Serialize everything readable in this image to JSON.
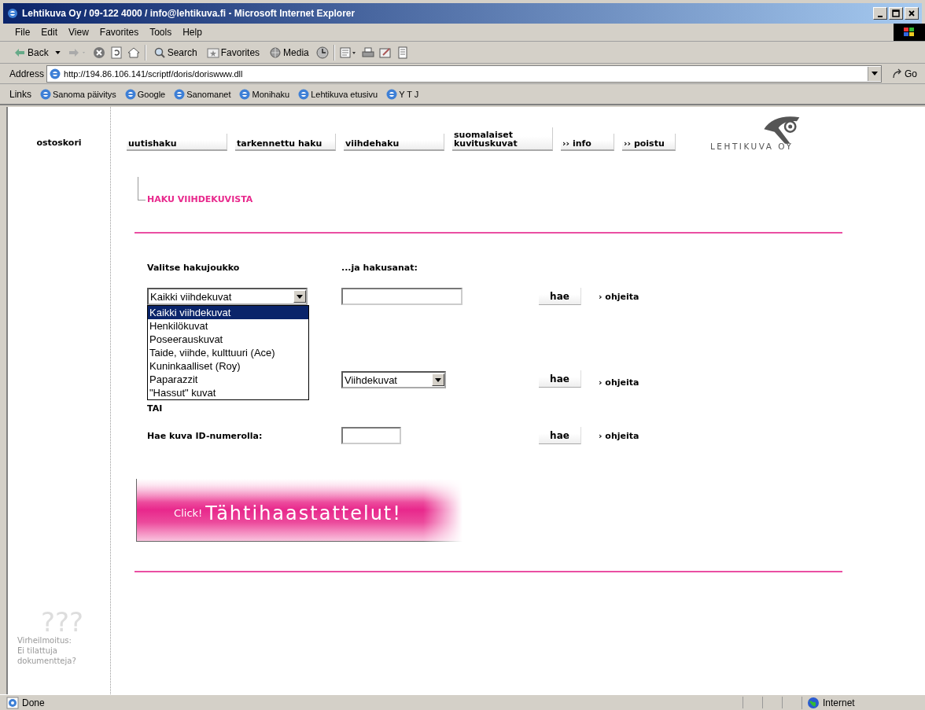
{
  "window": {
    "title": "Lehtikuva Oy / 09-122 4000 / info@lehtikuva.fi - Microsoft Internet Explorer"
  },
  "menu": [
    "File",
    "Edit",
    "View",
    "Favorites",
    "Tools",
    "Help"
  ],
  "toolbar": [
    {
      "kind": "back",
      "label": "Back"
    },
    {
      "kind": "forward"
    },
    {
      "kind": "stop"
    },
    {
      "kind": "refresh"
    },
    {
      "kind": "home"
    },
    {
      "kind": "search",
      "label": "Search"
    },
    {
      "kind": "favorites",
      "label": "Favorites"
    },
    {
      "kind": "media",
      "label": "Media"
    },
    {
      "kind": "history"
    },
    {
      "kind": "mail"
    },
    {
      "kind": "print"
    },
    {
      "kind": "edit"
    },
    {
      "kind": "discuss"
    }
  ],
  "address": {
    "label": "Address",
    "url": "http://194.86.106.141/scriptf/doris/doriswww.dll",
    "go": "Go"
  },
  "links": {
    "label": "Links",
    "items": [
      "Sanoma päivitys",
      "Google",
      "Sanomanet",
      "Monihaku",
      "Lehtikuva etusivu",
      "Y T J"
    ]
  },
  "sidebar": {
    "cart": "ostoskori",
    "marks": "???",
    "error_lines": [
      "Virheilmoitus:",
      "Ei tilattuja",
      "dokumentteja?"
    ]
  },
  "nav": [
    "uutishaku",
    "tarkennettu haku",
    "viihdehaku",
    "suomalaiset\nkuvituskuvat",
    "›› info",
    "›› poistu"
  ],
  "logo": "LEHTIKUVA OY",
  "heading": "HAKU VIIHDEKUVISTA",
  "form": {
    "set_label": "Valitse hakujoukko",
    "words_label": "...ja hakusanat:",
    "set_select": {
      "value": "Kaikki viihdekuvat",
      "expanded": true,
      "options": [
        {
          "label": "Kaikki viihdekuvat",
          "selected": true
        },
        {
          "label": "Henkilökuvat",
          "selected": false
        },
        {
          "label": "Poseerauskuvat",
          "selected": false
        },
        {
          "label": "Taide, viihde, kulttuuri (Ace)",
          "selected": false
        },
        {
          "label": "Kuninkaalliset (Roy)",
          "selected": false
        },
        {
          "label": "Paparazzit",
          "selected": false
        },
        {
          "label": "\"Hassut\" kuvat",
          "selected": false
        }
      ]
    },
    "second_select": "Viihdekuvat",
    "or": "TAI",
    "id_label": "Hae kuva ID-numerolla:",
    "search_buttons": [
      "hae",
      "hae",
      "hae"
    ],
    "help_links": [
      "› ohjeita",
      "› ohjeita",
      "› ohjeita"
    ]
  },
  "banner": {
    "small": "Click!",
    "big": "Tähtihaastattelut!"
  },
  "status": {
    "text": "Done",
    "zone": "Internet"
  }
}
